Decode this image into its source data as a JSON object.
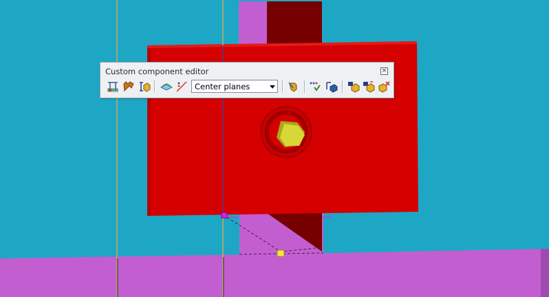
{
  "toolbar": {
    "title": "Custom component editor",
    "close_icon": "close-icon",
    "center_planes_value": "Center planes",
    "buttons": [
      {
        "name": "define-points-button",
        "icon": "points-icon"
      },
      {
        "name": "fix-button",
        "icon": "fix-icon"
      },
      {
        "name": "bind-to-plane-button",
        "icon": "bind-plane-icon"
      },
      {
        "name": "display-planes-button",
        "icon": "planes-icon"
      },
      {
        "name": "distance-button",
        "icon": "distance-icon"
      },
      {
        "name": "show-variables-button",
        "icon": "variables-icon"
      },
      {
        "name": "test-button",
        "icon": "test-icon"
      },
      {
        "name": "magnetic-plane-button",
        "icon": "magnetic-icon"
      },
      {
        "name": "save-component-button",
        "icon": "save-icon"
      },
      {
        "name": "save-as-button",
        "icon": "save-as-icon"
      },
      {
        "name": "close-editor-button",
        "icon": "close-editor-icon"
      }
    ]
  },
  "colors": {
    "background": "#1ea7c5",
    "plate": "#d50000",
    "beam": "#c35ed0",
    "web_dark": "#760000",
    "bolt": "#d7d736",
    "grid_line": "#c9a862"
  }
}
